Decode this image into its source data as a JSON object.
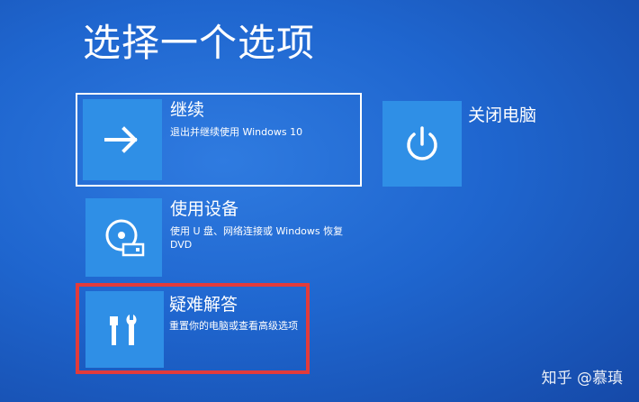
{
  "page": {
    "title": "选择一个选项"
  },
  "options": [
    {
      "key": "continue",
      "title": "继续",
      "description": "退出并继续使用 Windows 10",
      "icon": "arrow-right-icon"
    },
    {
      "key": "shutdown",
      "title": "关闭电脑",
      "description": "",
      "icon": "power-icon"
    },
    {
      "key": "use-device",
      "title": "使用设备",
      "description": "使用 U 盘、网络连接或 Windows 恢复 DVD",
      "icon": "disc-drive-icon"
    },
    {
      "key": "troubleshoot",
      "title": "疑难解答",
      "description": "重置你的电脑或查看高级选项",
      "icon": "tools-icon"
    }
  ],
  "watermark": {
    "text": "知乎 @慕瑱"
  },
  "colors": {
    "background": "#1f66cf",
    "tile": "#2f8fe6",
    "highlight": "#e23b3b"
  }
}
